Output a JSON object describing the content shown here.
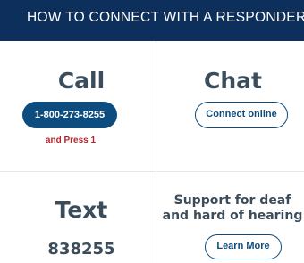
{
  "header": {
    "title": "HOW TO CONNECT WITH A RESPONDER"
  },
  "call": {
    "heading": "Call",
    "phone_button": "1-800-273-8255",
    "note": "and Press 1"
  },
  "chat": {
    "heading": "Chat",
    "button": "Connect online"
  },
  "text": {
    "heading": "Text",
    "number": "838255"
  },
  "deaf": {
    "heading_line1": "Support for deaf",
    "heading_line2": "and hard of hearing",
    "button": "Learn More"
  },
  "colors": {
    "header_bg": "#0c2f5c",
    "primary_button": "#0d4c7e",
    "note_red": "#b3252b",
    "heading_text": "#3b4c5a"
  }
}
